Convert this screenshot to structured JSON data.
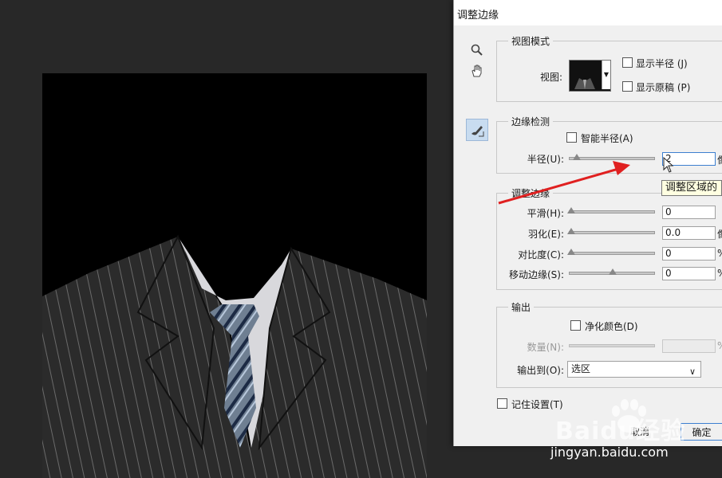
{
  "dialog": {
    "title": "调整边缘",
    "view_mode": {
      "legend": "视图模式",
      "view_label": "视图:",
      "show_radius": "显示半径 (J)",
      "show_original": "显示原稿 (P)"
    },
    "edge_detection": {
      "legend": "边缘检测",
      "smart_radius": "智能半径(A)",
      "radius_label": "半径(U):",
      "radius_value": "2",
      "radius_unit": "像",
      "radius_level": 0.08
    },
    "adjust_edge": {
      "legend": "调整边缘",
      "smooth_label": "平滑(H):",
      "smooth_value": "0",
      "feather_label": "羽化(E):",
      "feather_value": "0.0",
      "feather_unit": "像",
      "contrast_label": "对比度(C):",
      "contrast_value": "0",
      "contrast_unit": "%",
      "shift_label": "移动边缘(S):",
      "shift_value": "0",
      "shift_unit": "%",
      "shift_level": 0.5
    },
    "output": {
      "legend": "输出",
      "decontaminate": "净化颜色(D)",
      "amount_label": "数量(N):",
      "amount_unit": "%",
      "output_to_label": "输出到(O):",
      "output_to_value": "选区"
    },
    "remember": "记住设置(T)",
    "cancel": "取消",
    "ok": "确定"
  },
  "tooltip": "调整区域的",
  "watermark": {
    "brand": "Baidu经验",
    "url": "jingyan.baidu.com"
  },
  "colors": {
    "accent": "#3c7fd0",
    "arrow": "#e02020",
    "canvas_bg": "#282828"
  },
  "icons": [
    "zoom-icon",
    "hand-icon",
    "refine-radius-brush-icon"
  ]
}
